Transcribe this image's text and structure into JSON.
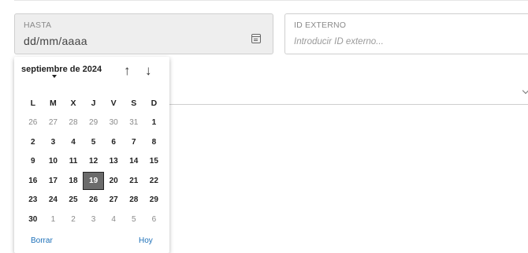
{
  "filters": {
    "hasta": {
      "label": "HASTA",
      "value": "dd/mm/aaaa"
    },
    "id_externo": {
      "label": "ID EXTERNO",
      "placeholder": "Introducir ID externo..."
    }
  },
  "datepicker": {
    "month_title": "septiembre de 2024",
    "weekdays": [
      "L",
      "M",
      "X",
      "J",
      "V",
      "S",
      "D"
    ],
    "weeks": [
      [
        {
          "d": "26",
          "o": true
        },
        {
          "d": "27",
          "o": true
        },
        {
          "d": "28",
          "o": true
        },
        {
          "d": "29",
          "o": true
        },
        {
          "d": "30",
          "o": true
        },
        {
          "d": "31",
          "o": true
        },
        {
          "d": "1"
        }
      ],
      [
        {
          "d": "2"
        },
        {
          "d": "3"
        },
        {
          "d": "4"
        },
        {
          "d": "5"
        },
        {
          "d": "6"
        },
        {
          "d": "7"
        },
        {
          "d": "8"
        }
      ],
      [
        {
          "d": "9"
        },
        {
          "d": "10"
        },
        {
          "d": "11"
        },
        {
          "d": "12"
        },
        {
          "d": "13"
        },
        {
          "d": "14"
        },
        {
          "d": "15"
        }
      ],
      [
        {
          "d": "16"
        },
        {
          "d": "17"
        },
        {
          "d": "18"
        },
        {
          "d": "19",
          "s": true
        },
        {
          "d": "20"
        },
        {
          "d": "21"
        },
        {
          "d": "22"
        }
      ],
      [
        {
          "d": "23"
        },
        {
          "d": "24"
        },
        {
          "d": "25"
        },
        {
          "d": "26"
        },
        {
          "d": "27"
        },
        {
          "d": "28"
        },
        {
          "d": "29"
        }
      ],
      [
        {
          "d": "30"
        },
        {
          "d": "1",
          "o": true
        },
        {
          "d": "2",
          "o": true
        },
        {
          "d": "3",
          "o": true
        },
        {
          "d": "4",
          "o": true
        },
        {
          "d": "5",
          "o": true
        },
        {
          "d": "6",
          "o": true
        }
      ]
    ],
    "nav": {
      "prev": "↑",
      "next": "↓"
    },
    "clear_label": "Borrar",
    "today_label": "Hoy",
    "colors": {
      "selected_bg": "#6b6b6b",
      "link": "#1c6fb8"
    },
    "icons": {
      "calendar": "calendar-icon",
      "caret": "caret-down-icon",
      "chevron": "chevron-down-icon"
    }
  }
}
